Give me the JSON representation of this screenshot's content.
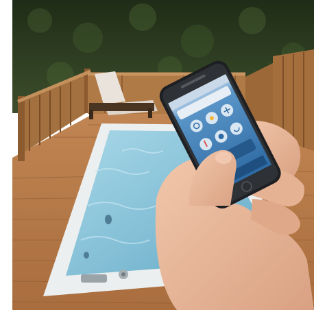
{
  "scene": {
    "description_icons": [
      "hedge",
      "wooden-deck",
      "wooden-railing",
      "lounge-chair",
      "swim-spa",
      "smartphone",
      "hand"
    ],
    "colors": {
      "hedge": "#2f3f24",
      "deck": "#b57a45",
      "railing": "#a8703f",
      "water": "#8cc6dc",
      "spa_shell": "#eef1f2",
      "phone_body": "#1d1f22",
      "phone_screen": "#3f7fb8",
      "skin": "#e9b89b"
    }
  },
  "phone_screen": {
    "control_icons": [
      "power-icon",
      "light-icon",
      "jets-icon",
      "heat-icon",
      "settings-icon",
      "pump-icon"
    ]
  }
}
